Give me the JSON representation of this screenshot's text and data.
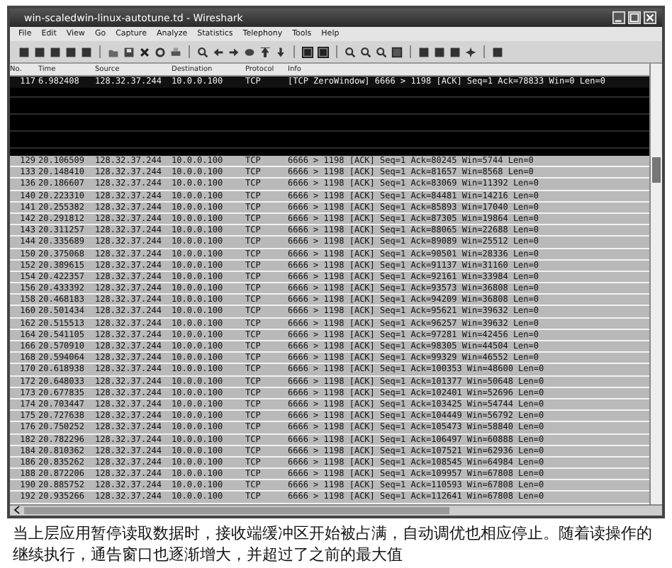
{
  "window": {
    "title": "win-scaledwin-linux-autotune.td - Wireshark"
  },
  "menu": [
    "File",
    "Edit",
    "View",
    "Go",
    "Capture",
    "Analyze",
    "Statistics",
    "Telephony",
    "Tools",
    "Help"
  ],
  "columns": [
    "No.",
    "Time",
    "Source",
    "Destination",
    "Protocol",
    "Info"
  ],
  "rows": [
    {
      "kind": "zero_window",
      "no": "117",
      "time": "6.982408",
      "source": "128.32.37.244",
      "destination": "10.0.0.100",
      "protocol": "TCP",
      "info": "[TCP ZeroWindow] 6666 > 1198 [ACK] Seq=1 Ack=78833 Win=0 Len=0"
    },
    {
      "kind": "gap"
    },
    {
      "kind": "normal",
      "no": "129",
      "time": "20.106509",
      "source": "128.32.37.244",
      "destination": "10.0.0.100",
      "protocol": "TCP",
      "info": "6666 > 1198 [ACK] Seq=1 Ack=80245 Win=5744 Len=0"
    },
    {
      "kind": "normal",
      "no": "133",
      "time": "20.148410",
      "source": "128.32.37.244",
      "destination": "10.0.0.100",
      "protocol": "TCP",
      "info": "6666 > 1198 [ACK] Seq=1 Ack=81657 Win=8568 Len=0"
    },
    {
      "kind": "normal",
      "no": "136",
      "time": "20.186607",
      "source": "128.32.37.244",
      "destination": "10.0.0.100",
      "protocol": "TCP",
      "info": "6666 > 1198 [ACK] Seq=1 Ack=83069 Win=11392 Len=0"
    },
    {
      "kind": "normal",
      "no": "140",
      "time": "20.223310",
      "source": "128.32.37.244",
      "destination": "10.0.0.100",
      "protocol": "TCP",
      "info": "6666 > 1198 [ACK] Seq=1 Ack=84481 Win=14216 Len=0"
    },
    {
      "kind": "normal",
      "no": "141",
      "time": "20.255382",
      "source": "128.32.37.244",
      "destination": "10.0.0.100",
      "protocol": "TCP",
      "info": "6666 > 1198 [ACK] Seq=1 Ack=85893 Win=17040 Len=0"
    },
    {
      "kind": "normal",
      "no": "142",
      "time": "20.291812",
      "source": "128.32.37.244",
      "destination": "10.0.0.100",
      "protocol": "TCP",
      "info": "6666 > 1198 [ACK] Seq=1 Ack=87305 Win=19864 Len=0"
    },
    {
      "kind": "normal",
      "no": "143",
      "time": "20.311257",
      "source": "128.32.37.244",
      "destination": "10.0.0.100",
      "protocol": "TCP",
      "info": "6666 > 1198 [ACK] Seq=1 Ack=88065 Win=22688 Len=0"
    },
    {
      "kind": "normal",
      "no": "144",
      "time": "20.335689",
      "source": "128.32.37.244",
      "destination": "10.0.0.100",
      "protocol": "TCP",
      "info": "6666 > 1198 [ACK] Seq=1 Ack=89089 Win=25512 Len=0"
    },
    {
      "kind": "normal",
      "no": "150",
      "time": "20.375068",
      "source": "128.32.37.244",
      "destination": "10.0.0.100",
      "protocol": "TCP",
      "info": "6666 > 1198 [ACK] Seq=1 Ack=90501 Win=28336 Len=0"
    },
    {
      "kind": "normal",
      "no": "152",
      "time": "20.389615",
      "source": "128.32.37.244",
      "destination": "10.0.0.100",
      "protocol": "TCP",
      "info": "6666 > 1198 [ACK] Seq=1 Ack=91137 Win=31160 Len=0"
    },
    {
      "kind": "normal",
      "no": "154",
      "time": "20.422357",
      "source": "128.32.37.244",
      "destination": "10.0.0.100",
      "protocol": "TCP",
      "info": "6666 > 1198 [ACK] Seq=1 Ack=92161 Win=33984 Len=0"
    },
    {
      "kind": "normal",
      "no": "156",
      "time": "20.433392",
      "source": "128.32.37.244",
      "destination": "10.0.0.100",
      "protocol": "TCP",
      "info": "6666 > 1198 [ACK] Seq=1 Ack=93573 Win=36808 Len=0"
    },
    {
      "kind": "normal",
      "no": "158",
      "time": "20.468183",
      "source": "128.32.37.244",
      "destination": "10.0.0.100",
      "protocol": "TCP",
      "info": "6666 > 1198 [ACK] Seq=1 Ack=94209 Win=36808 Len=0"
    },
    {
      "kind": "normal",
      "no": "160",
      "time": "20.501434",
      "source": "128.32.37.244",
      "destination": "10.0.0.100",
      "protocol": "TCP",
      "info": "6666 > 1198 [ACK] Seq=1 Ack=95621 Win=39632 Len=0"
    },
    {
      "kind": "normal",
      "no": "162",
      "time": "20.515513",
      "source": "128.32.37.244",
      "destination": "10.0.0.100",
      "protocol": "TCP",
      "info": "6666 > 1198 [ACK] Seq=1 Ack=96257 Win=39632 Len=0"
    },
    {
      "kind": "normal",
      "no": "164",
      "time": "20.541105",
      "source": "128.32.37.244",
      "destination": "10.0.0.100",
      "protocol": "TCP",
      "info": "6666 > 1198 [ACK] Seq=1 Ack=97281 Win=42456 Len=0"
    },
    {
      "kind": "normal",
      "no": "166",
      "time": "20.570910",
      "source": "128.32.37.244",
      "destination": "10.0.0.100",
      "protocol": "TCP",
      "info": "6666 > 1198 [ACK] Seq=1 Ack=98305 Win=44504 Len=0"
    },
    {
      "kind": "normal",
      "no": "168",
      "time": "20.594064",
      "source": "128.32.37.244",
      "destination": "10.0.0.100",
      "protocol": "TCP",
      "info": "6666 > 1198 [ACK] Seq=1 Ack=99329 Win=46552 Len=0"
    },
    {
      "kind": "normal",
      "no": "170",
      "time": "20.618938",
      "source": "128.32.37.244",
      "destination": "10.0.0.100",
      "protocol": "TCP",
      "info": "6666 > 1198 [ACK] Seq=1 Ack=100353 Win=48600 Len=0"
    },
    {
      "kind": "normal",
      "no": "172",
      "time": "20.648033",
      "source": "128.32.37.244",
      "destination": "10.0.0.100",
      "protocol": "TCP",
      "info": "6666 > 1198 [ACK] Seq=1 Ack=101377 Win=50648 Len=0"
    },
    {
      "kind": "normal",
      "no": "173",
      "time": "20.677835",
      "source": "128.32.37.244",
      "destination": "10.0.0.100",
      "protocol": "TCP",
      "info": "6666 > 1198 [ACK] Seq=1 Ack=102401 Win=52696 Len=0"
    },
    {
      "kind": "normal",
      "no": "174",
      "time": "20.703447",
      "source": "128.32.37.244",
      "destination": "10.0.0.100",
      "protocol": "TCP",
      "info": "6666 > 1198 [ACK] Seq=1 Ack=103425 Win=54744 Len=0"
    },
    {
      "kind": "normal",
      "no": "175",
      "time": "20.727638",
      "source": "128.32.37.244",
      "destination": "10.0.0.100",
      "protocol": "TCP",
      "info": "6666 > 1198 [ACK] Seq=1 Ack=104449 Win=56792 Len=0"
    },
    {
      "kind": "normal",
      "no": "176",
      "time": "20.750252",
      "source": "128.32.37.244",
      "destination": "10.0.0.100",
      "protocol": "TCP",
      "info": "6666 > 1198 [ACK] Seq=1 Ack=105473 Win=58840 Len=0"
    },
    {
      "kind": "normal",
      "no": "182",
      "time": "20.782296",
      "source": "128.32.37.244",
      "destination": "10.0.0.100",
      "protocol": "TCP",
      "info": "6666 > 1198 [ACK] Seq=1 Ack=106497 Win=60888 Len=0"
    },
    {
      "kind": "normal",
      "no": "184",
      "time": "20.810362",
      "source": "128.32.37.244",
      "destination": "10.0.0.100",
      "protocol": "TCP",
      "info": "6666 > 1198 [ACK] Seq=1 Ack=107521 Win=62936 Len=0"
    },
    {
      "kind": "normal",
      "no": "186",
      "time": "20.835262",
      "source": "128.32.37.244",
      "destination": "10.0.0.100",
      "protocol": "TCP",
      "info": "6666 > 1198 [ACK] Seq=1 Ack=108545 Win=64984 Len=0"
    },
    {
      "kind": "normal",
      "no": "188",
      "time": "20.872206",
      "source": "128.32.37.244",
      "destination": "10.0.0.100",
      "protocol": "TCP",
      "info": "6666 > 1198 [ACK] Seq=1 Ack=109957 Win=67808 Len=0"
    },
    {
      "kind": "normal",
      "no": "190",
      "time": "20.885752",
      "source": "128.32.37.244",
      "destination": "10.0.0.100",
      "protocol": "TCP",
      "info": "6666 > 1198 [ACK] Seq=1 Ack=110593 Win=67808 Len=0"
    },
    {
      "kind": "normal",
      "no": "192",
      "time": "20.935266",
      "source": "128.32.37.244",
      "destination": "10.0.0.100",
      "protocol": "TCP",
      "info": "6666 > 1198 [ACK] Seq=1 Ack=112641 Win=67808 Len=0"
    }
  ],
  "caption": "当上层应用暂停读取数据时，接收端缓冲区开始被占满，自动调优也相应停止。随着读操作的继续执行，通告窗口也逐渐增大，并超过了之前的最大值"
}
